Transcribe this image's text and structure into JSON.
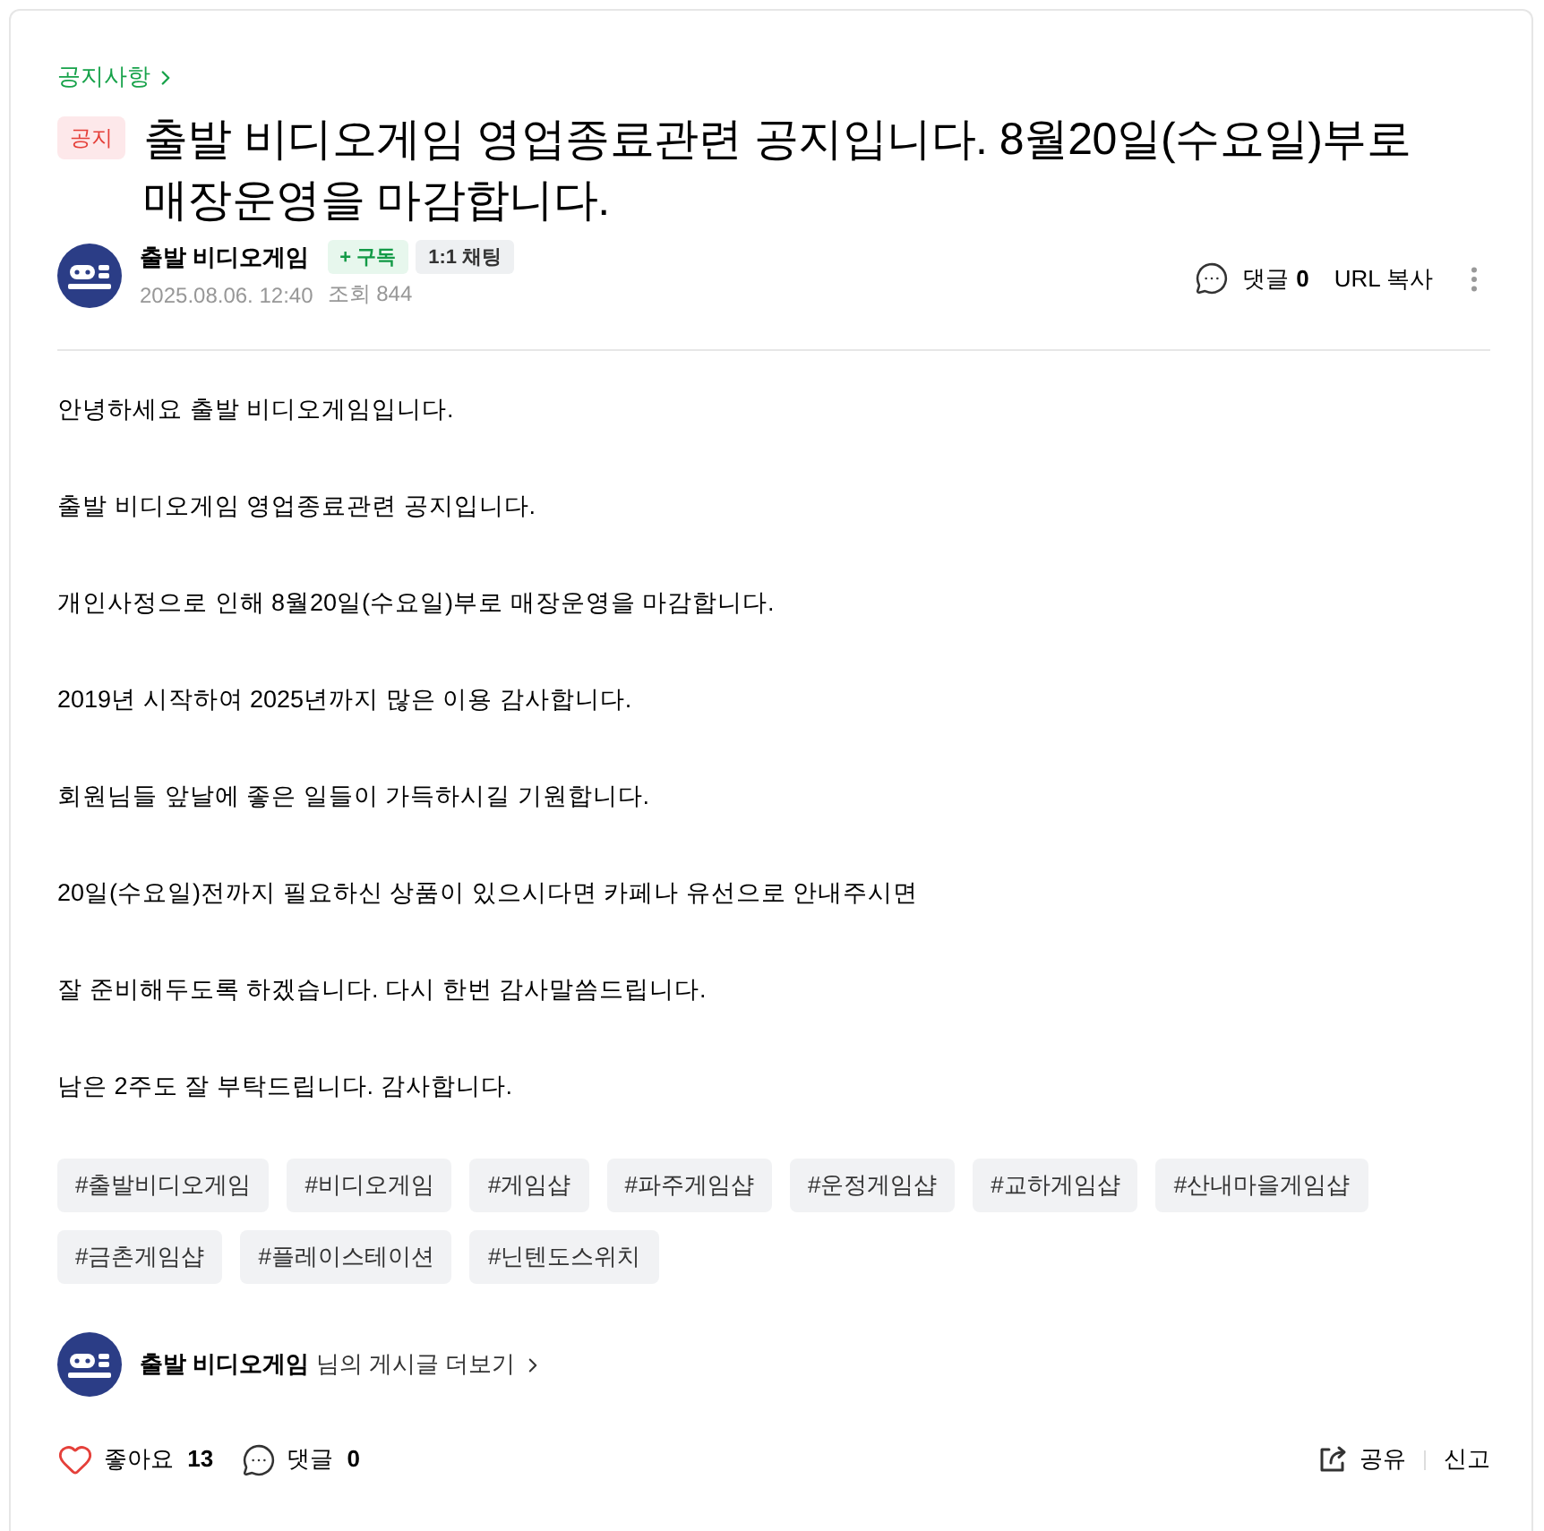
{
  "breadcrumb": {
    "label": "공지사항"
  },
  "title": {
    "badge": "공지",
    "text": "출발 비디오게임 영업종료관련 공지입니다. 8월20일(수요일)부로 매장운영을 마감합니다."
  },
  "author": {
    "name": "출발 비디오게임",
    "subscribe": "+ 구독",
    "chat": "1:1 채팅",
    "date": "2025.08.06. 12:40",
    "views": "조회 844"
  },
  "actions": {
    "comments_label": "댓글",
    "comments": "0",
    "copy_url": "URL 복사"
  },
  "body": [
    "안녕하세요 출발 비디오게임입니다.",
    "출발 비디오게임 영업종료관련 공지입니다.",
    "개인사정으로 인해 8월20일(수요일)부로 매장운영을 마감합니다.",
    "2019년 시작하여 2025년까지 많은 이용 감사합니다.",
    "회원님들 앞날에 좋은 일들이 가득하시길 기원합니다.",
    "20일(수요일)전까지 필요하신 상품이 있으시다면 카페나 유선으로 안내주시면",
    "잘 준비해두도록 하겠습니다. 다시 한번 감사말씀드립니다.",
    "남은 2주도 잘 부탁드립니다. 감사합니다."
  ],
  "tags": [
    "#출발비디오게임",
    "#비디오게임",
    "#게임샵",
    "#파주게임샵",
    "#운정게임샵",
    "#교하게임샵",
    "#산내마을게임샵",
    "#금촌게임샵",
    "#플레이스테이션",
    "#닌텐도스위치"
  ],
  "more_posts": {
    "name": "출발 비디오게임",
    "suffix": "님의 게시글 더보기"
  },
  "footer": {
    "liked": false,
    "likes_label": "좋아요",
    "likes": "13",
    "comments_label": "댓글",
    "comments": "0",
    "share": "공유",
    "report": "신고"
  }
}
